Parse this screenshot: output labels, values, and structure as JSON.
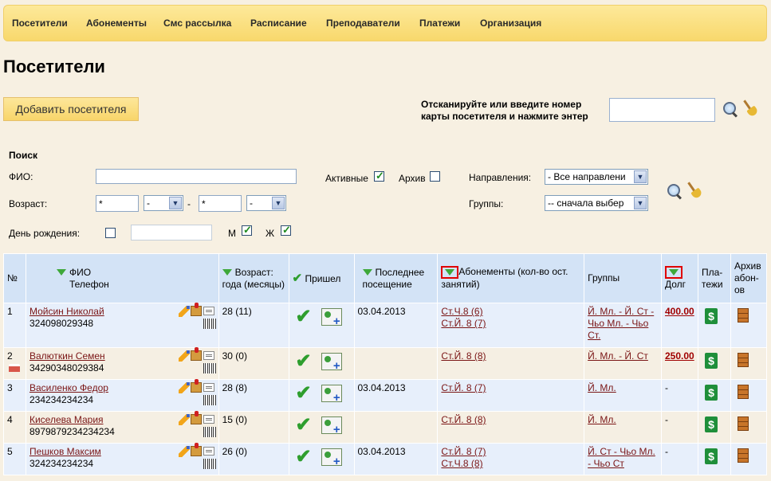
{
  "nav": {
    "items": [
      "Посетители",
      "Абонементы",
      "Смс рассылка",
      "Расписание",
      "Преподаватели",
      "Платежи",
      "Организация"
    ]
  },
  "page": {
    "title": "Посетители",
    "add_button": "Добавить посетителя",
    "scan_label": "Отсканируйте или введите номер карты посетителя и нажмите энтер",
    "scan_value": ""
  },
  "search": {
    "heading": "Поиск",
    "fio_label": "ФИО:",
    "fio_value": "",
    "active_label": "Активные",
    "active_checked": true,
    "archive_label": "Архив",
    "archive_checked": false,
    "directions_label": "Направления:",
    "directions_value": "- Все направлени",
    "age_label": "Возраст:",
    "age_from_years": "*",
    "age_from_months": "-",
    "age_dash": "-",
    "age_to_years": "*",
    "age_to_months": "-",
    "groups_label": "Группы:",
    "groups_value": "-- сначала выбер",
    "birthday_label": "День рождения:",
    "birthday_checked": false,
    "birthday_value": "",
    "m_label": "М",
    "m_checked": true,
    "f_label": "Ж",
    "f_checked": true
  },
  "table": {
    "headers": {
      "num": "№",
      "fio": "ФИО",
      "phone": "Телефон",
      "age": "Возраст: года (месяцы)",
      "came": "Пришел",
      "last_visit": "Последнее посещение",
      "subs": "Абонементы (кол-во ост. занятий)",
      "groups": "Группы",
      "debt": "Долг",
      "payments": "Пла-тежи",
      "archive": "Архив абон-ов"
    },
    "rows": [
      {
        "num": "1",
        "name": "Мойсин Николай",
        "phone": "324098029348",
        "age": "28 (11)",
        "last_visit": "03.04.2013",
        "subs": [
          "Ст.Ч.8 (6)",
          "Ст.Й. 8 (7)"
        ],
        "groups": "Й. Мл. - Й. Ст - Чьо Мл. - Чьо Ст.",
        "debt": "400.00",
        "birthday": false
      },
      {
        "num": "2",
        "name": "Валюткин Семен",
        "phone": "34290348029384",
        "age": "30 (0)",
        "last_visit": "",
        "subs": [
          "Ст.Й. 8 (8)"
        ],
        "groups": "Й. Мл. - Й. Ст",
        "debt": "250.00",
        "birthday": true
      },
      {
        "num": "3",
        "name": "Василенко Федор",
        "phone": "234234234234",
        "age": "28 (8)",
        "last_visit": "03.04.2013",
        "subs": [
          "Ст.Й. 8 (7)"
        ],
        "groups": "Й. Мл.",
        "debt": "-",
        "birthday": false
      },
      {
        "num": "4",
        "name": "Киселева Мария",
        "phone": "8979879234234234",
        "age": "15 (0)",
        "last_visit": "",
        "subs": [
          "Ст.Й. 8 (8)"
        ],
        "groups": "Й. Мл.",
        "debt": "-",
        "birthday": false
      },
      {
        "num": "5",
        "name": "Пешков Максим",
        "phone": "324234234234",
        "age": "26 (0)",
        "last_visit": "03.04.2013",
        "subs": [
          "Ст.Й. 8 (7)",
          "Ст.Ч.8 (8)"
        ],
        "groups": "Й. Ст - Чьо Мл. - Чьо Ст",
        "debt": "-",
        "birthday": false
      }
    ]
  }
}
